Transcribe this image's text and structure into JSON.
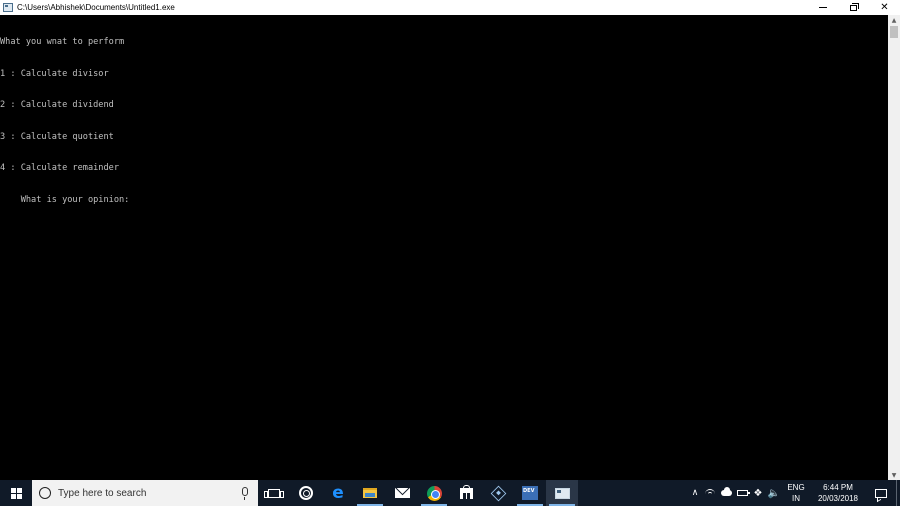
{
  "window": {
    "title": "C:\\Users\\Abhishek\\Documents\\Untitled1.exe",
    "controls": [
      "minimize",
      "restore",
      "close"
    ],
    "close_glyph": "✕"
  },
  "console": {
    "lines": [
      "What you wnat to perform",
      "1 : Calculate divisor",
      "2 : Calculate dividend",
      "3 : Calculate quotient",
      "4 : Calculate remainder",
      "    What is your opinion:"
    ],
    "text_color": "#c0c0c0",
    "background": "#000000"
  },
  "scrollbar": {
    "up_glyph": "▲",
    "down_glyph": "▼"
  },
  "taskbar": {
    "search_placeholder": "Type here to search",
    "pinned": [
      "task-view-icon",
      "cortana-icon",
      "edge-icon",
      "file-explorer-icon",
      "mail-icon",
      "chrome-icon",
      "store-icon",
      "virtualbox-icon",
      "devcpp-icon",
      "console-window-icon"
    ],
    "tray": {
      "chevron": "∧",
      "dropbox_glyph": "❖",
      "volume_glyph": "🔈",
      "language_top": "ENG",
      "language_bottom": "IN",
      "time": "6:44 PM",
      "date": "20/03/2018"
    },
    "accent_color": "#7fb5e8",
    "background": "#101a28"
  }
}
